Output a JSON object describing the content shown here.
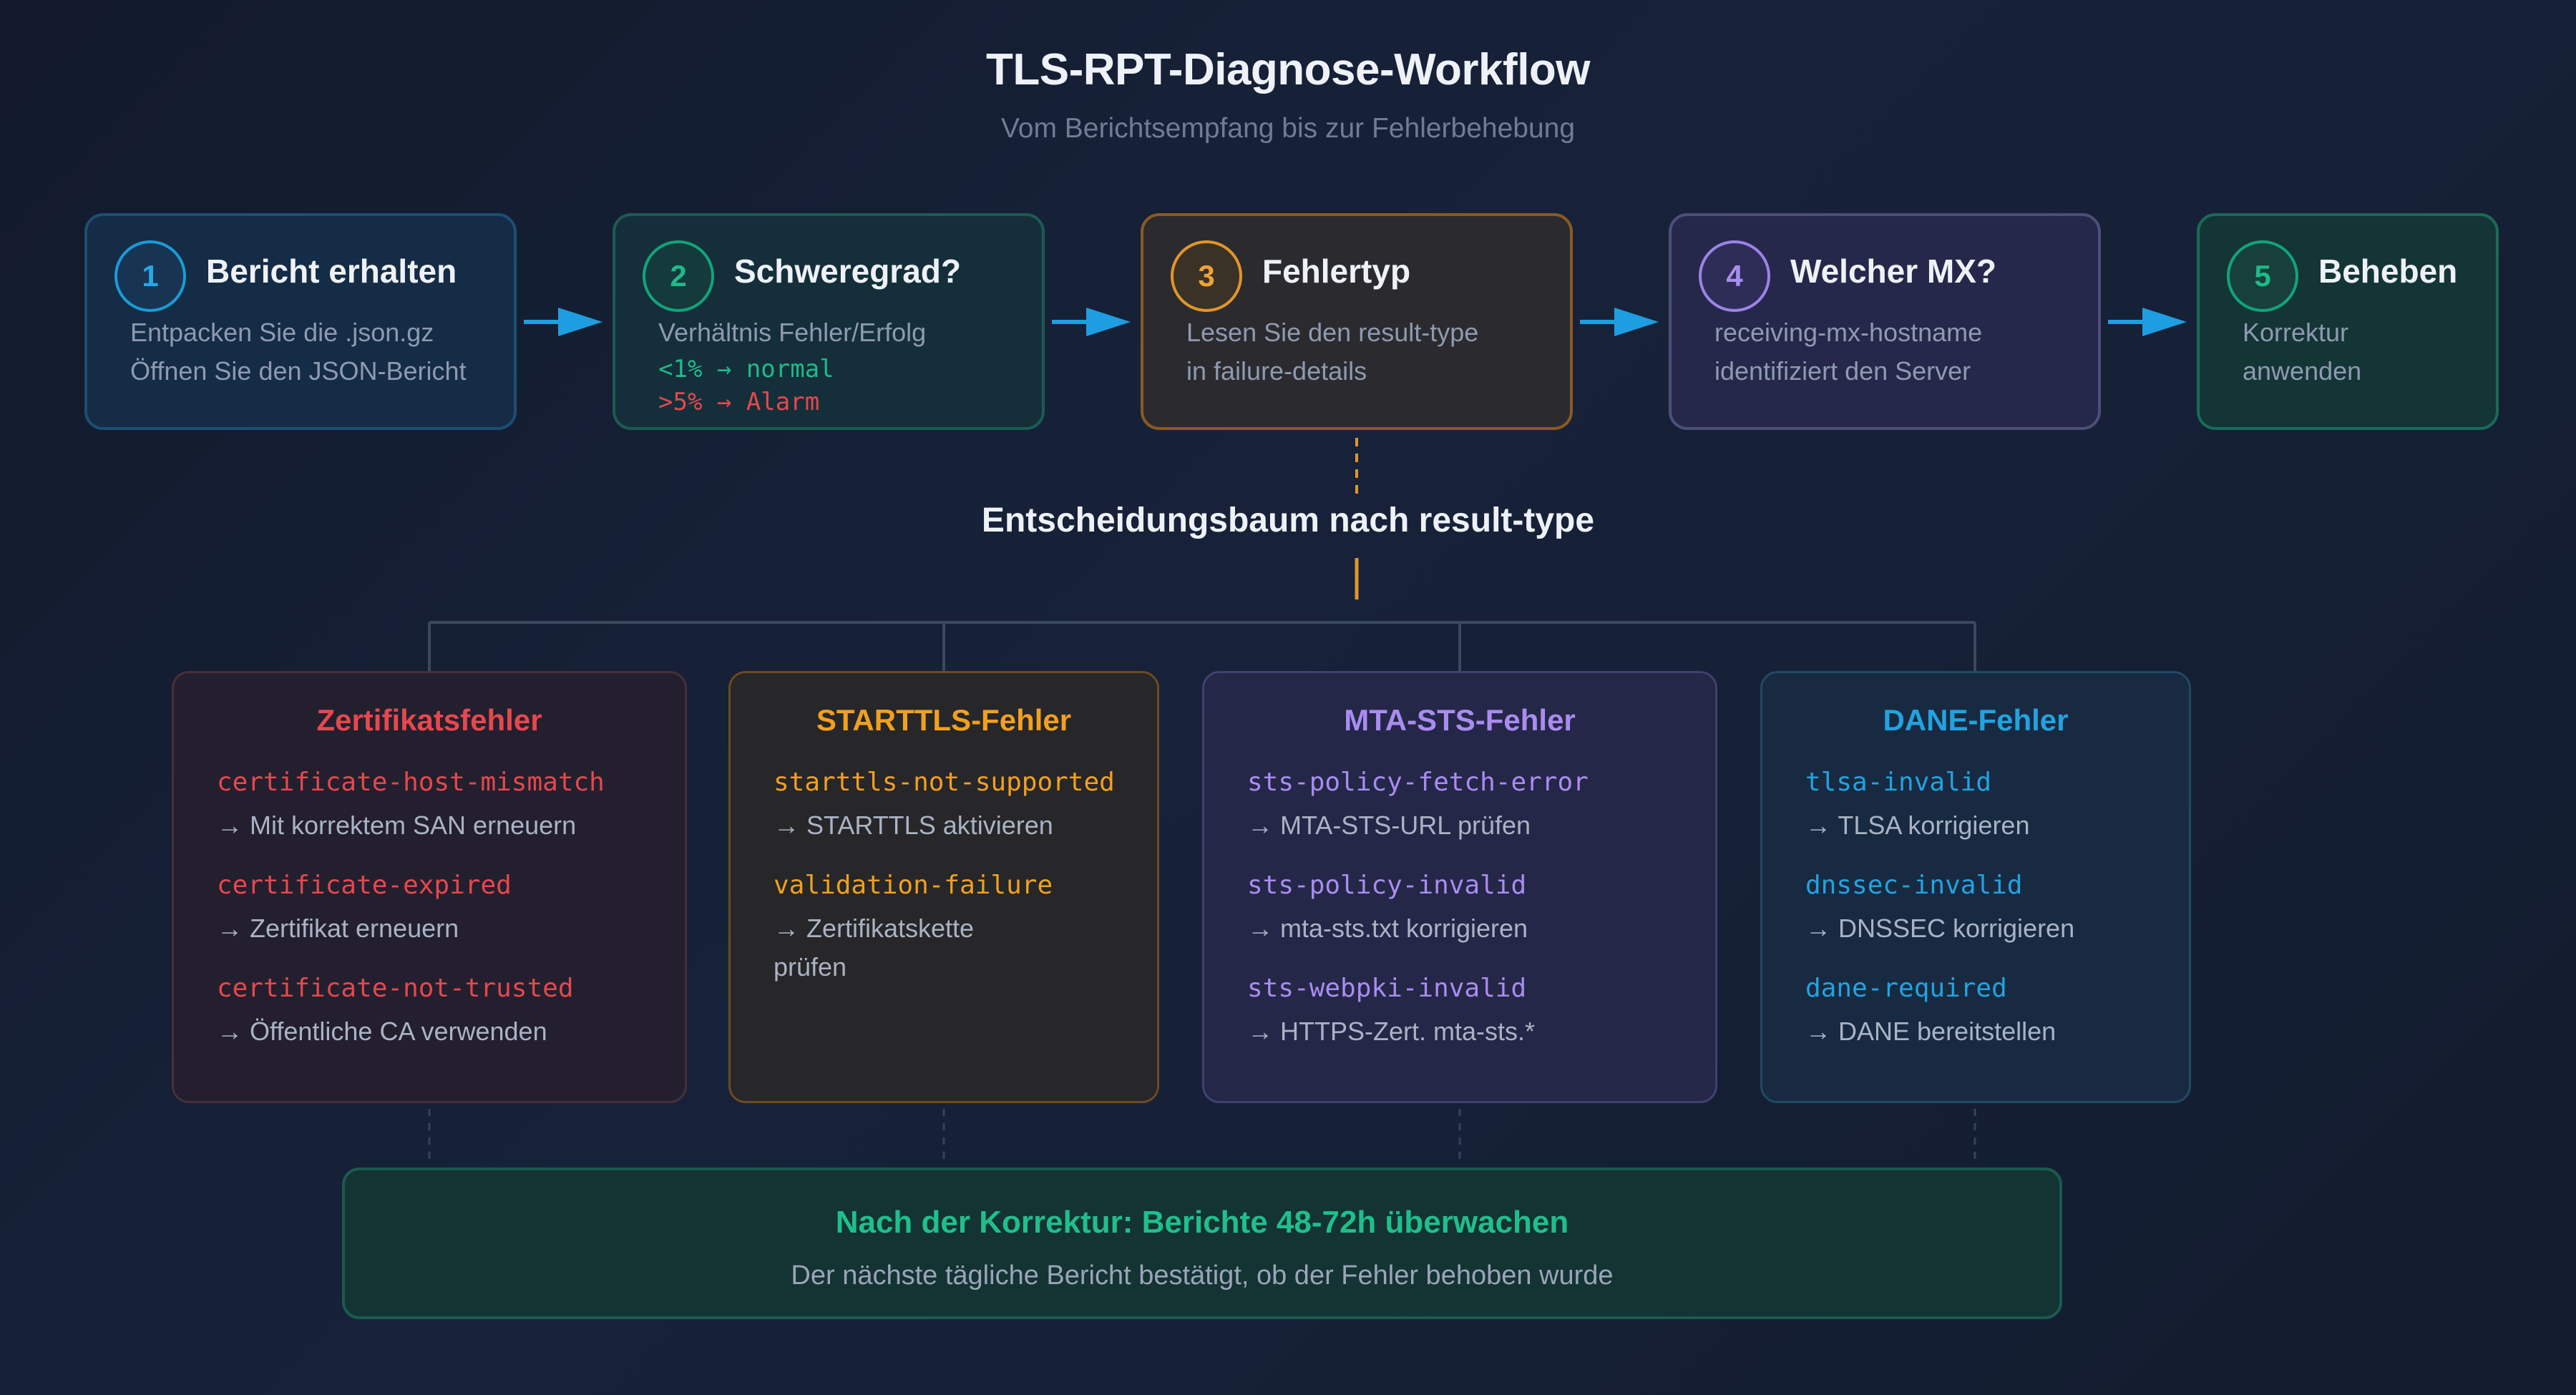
{
  "header": {
    "title": "TLS-RPT-Diagnose-Workflow",
    "subtitle": "Vom Berichtsempfang bis zur Fehlerbehebung"
  },
  "steps": [
    {
      "number": "1",
      "title": "Bericht erhalten",
      "lines": [
        "Entpacken Sie die .json.gz",
        "Öffnen Sie den JSON-Bericht"
      ]
    },
    {
      "number": "2",
      "title": "Schweregrad?",
      "lines": [
        "Verhältnis Fehler/Erfolg",
        "<1% → normal",
        ">5% → Alarm"
      ]
    },
    {
      "number": "3",
      "title": "Fehlertyp",
      "lines": [
        "Lesen Sie den result-type",
        "in failure-details"
      ]
    },
    {
      "number": "4",
      "title": "Welcher MX?",
      "lines": [
        "receiving-mx-hostname",
        "identifiziert den Server"
      ]
    },
    {
      "number": "5",
      "title": "Beheben",
      "lines": [
        "Korrektur",
        "anwenden"
      ]
    }
  ],
  "decision_tree_title": "Entscheidungsbaum nach result-type",
  "categories": [
    {
      "title": "Zertifikatsfehler",
      "items": [
        {
          "code": "certificate-host-mismatch",
          "action": "→ Mit korrektem SAN erneuern"
        },
        {
          "code": "certificate-expired",
          "action": "→ Zertifikat erneuern"
        },
        {
          "code": "certificate-not-trusted",
          "action": "→ Öffentliche CA verwenden"
        }
      ]
    },
    {
      "title": "STARTTLS-Fehler",
      "items": [
        {
          "code": "starttls-not-supported",
          "action": "→ STARTTLS aktivieren"
        },
        {
          "code": "validation-failure",
          "action": "→ Zertifikatskette",
          "action_cont": "prüfen"
        }
      ]
    },
    {
      "title": "MTA-STS-Fehler",
      "items": [
        {
          "code": "sts-policy-fetch-error",
          "action": "→ MTA-STS-URL prüfen"
        },
        {
          "code": "sts-policy-invalid",
          "action": "→ mta-sts.txt korrigieren"
        },
        {
          "code": "sts-webpki-invalid",
          "action": "→ HTTPS-Zert. mta-sts.*"
        }
      ]
    },
    {
      "title": "DANE-Fehler",
      "items": [
        {
          "code": "tlsa-invalid",
          "action": "→ TLSA korrigieren"
        },
        {
          "code": "dnssec-invalid",
          "action": "→ DNSSEC korrigieren"
        },
        {
          "code": "dane-required",
          "action": "→ DANE bereitstellen"
        }
      ]
    }
  ],
  "footer": {
    "title": "Nach der Korrektur: Berichte 48-72h überwachen",
    "subtitle": "Der nächste tägliche Bericht bestätigt, ob der Fehler behoben wurde"
  },
  "colors": {
    "arrow": "#1e9ee0",
    "ok": "#1fba8a",
    "alarm": "#e5484d",
    "cert": "#e5484d",
    "starttls": "#f0a020",
    "mtasts": "#a98cf0",
    "dane": "#22a3df",
    "footer_accent": "#1fbf8c"
  }
}
